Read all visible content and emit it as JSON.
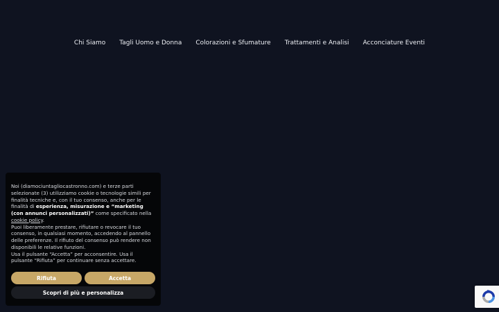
{
  "nav": {
    "items": [
      {
        "label": "Chi Siamo"
      },
      {
        "label": "Tagli Uomo e Donna"
      },
      {
        "label": "Colorazioni e Sfumature"
      },
      {
        "label": "Trattamenti e Analisi"
      },
      {
        "label": "Acconciature Eventi"
      }
    ]
  },
  "cookie_banner": {
    "text_1": "Noi (diamociuntagliocastronno.com) e terze parti selezionate (3) utilizziamo cookie o tecnologie simili per finalità tecniche e, con il tuo consenso, anche per le finalità di ",
    "text_bold": "esperienza, misurazione e “marketing (con annunci personalizzati)”",
    "text_2": " come specificato nella ",
    "policy_link": "cookie policy",
    "text_3": ".",
    "text_4": "Puoi liberamente prestare, rifiutare o revocare il tuo consenso, in qualsiasi momento, accedendo al pannello delle preferenze. Il rifiuto del consenso può rendere non disponibili le relative funzioni.",
    "text_5": "Usa il pulsante “Accetta” per acconsentire. Usa il pulsante “Rifiuta” per continuare senza accettare.",
    "reject_label": "Rifiuta",
    "accept_label": "Accetta",
    "more_label": "Scopri di più e personalizza"
  },
  "icons": {
    "recaptcha": "recaptcha-icon"
  },
  "colors": {
    "background": "#0f1320",
    "panel": "#050608",
    "accent": "#c7a767",
    "secondary_button": "#1b1d23"
  }
}
